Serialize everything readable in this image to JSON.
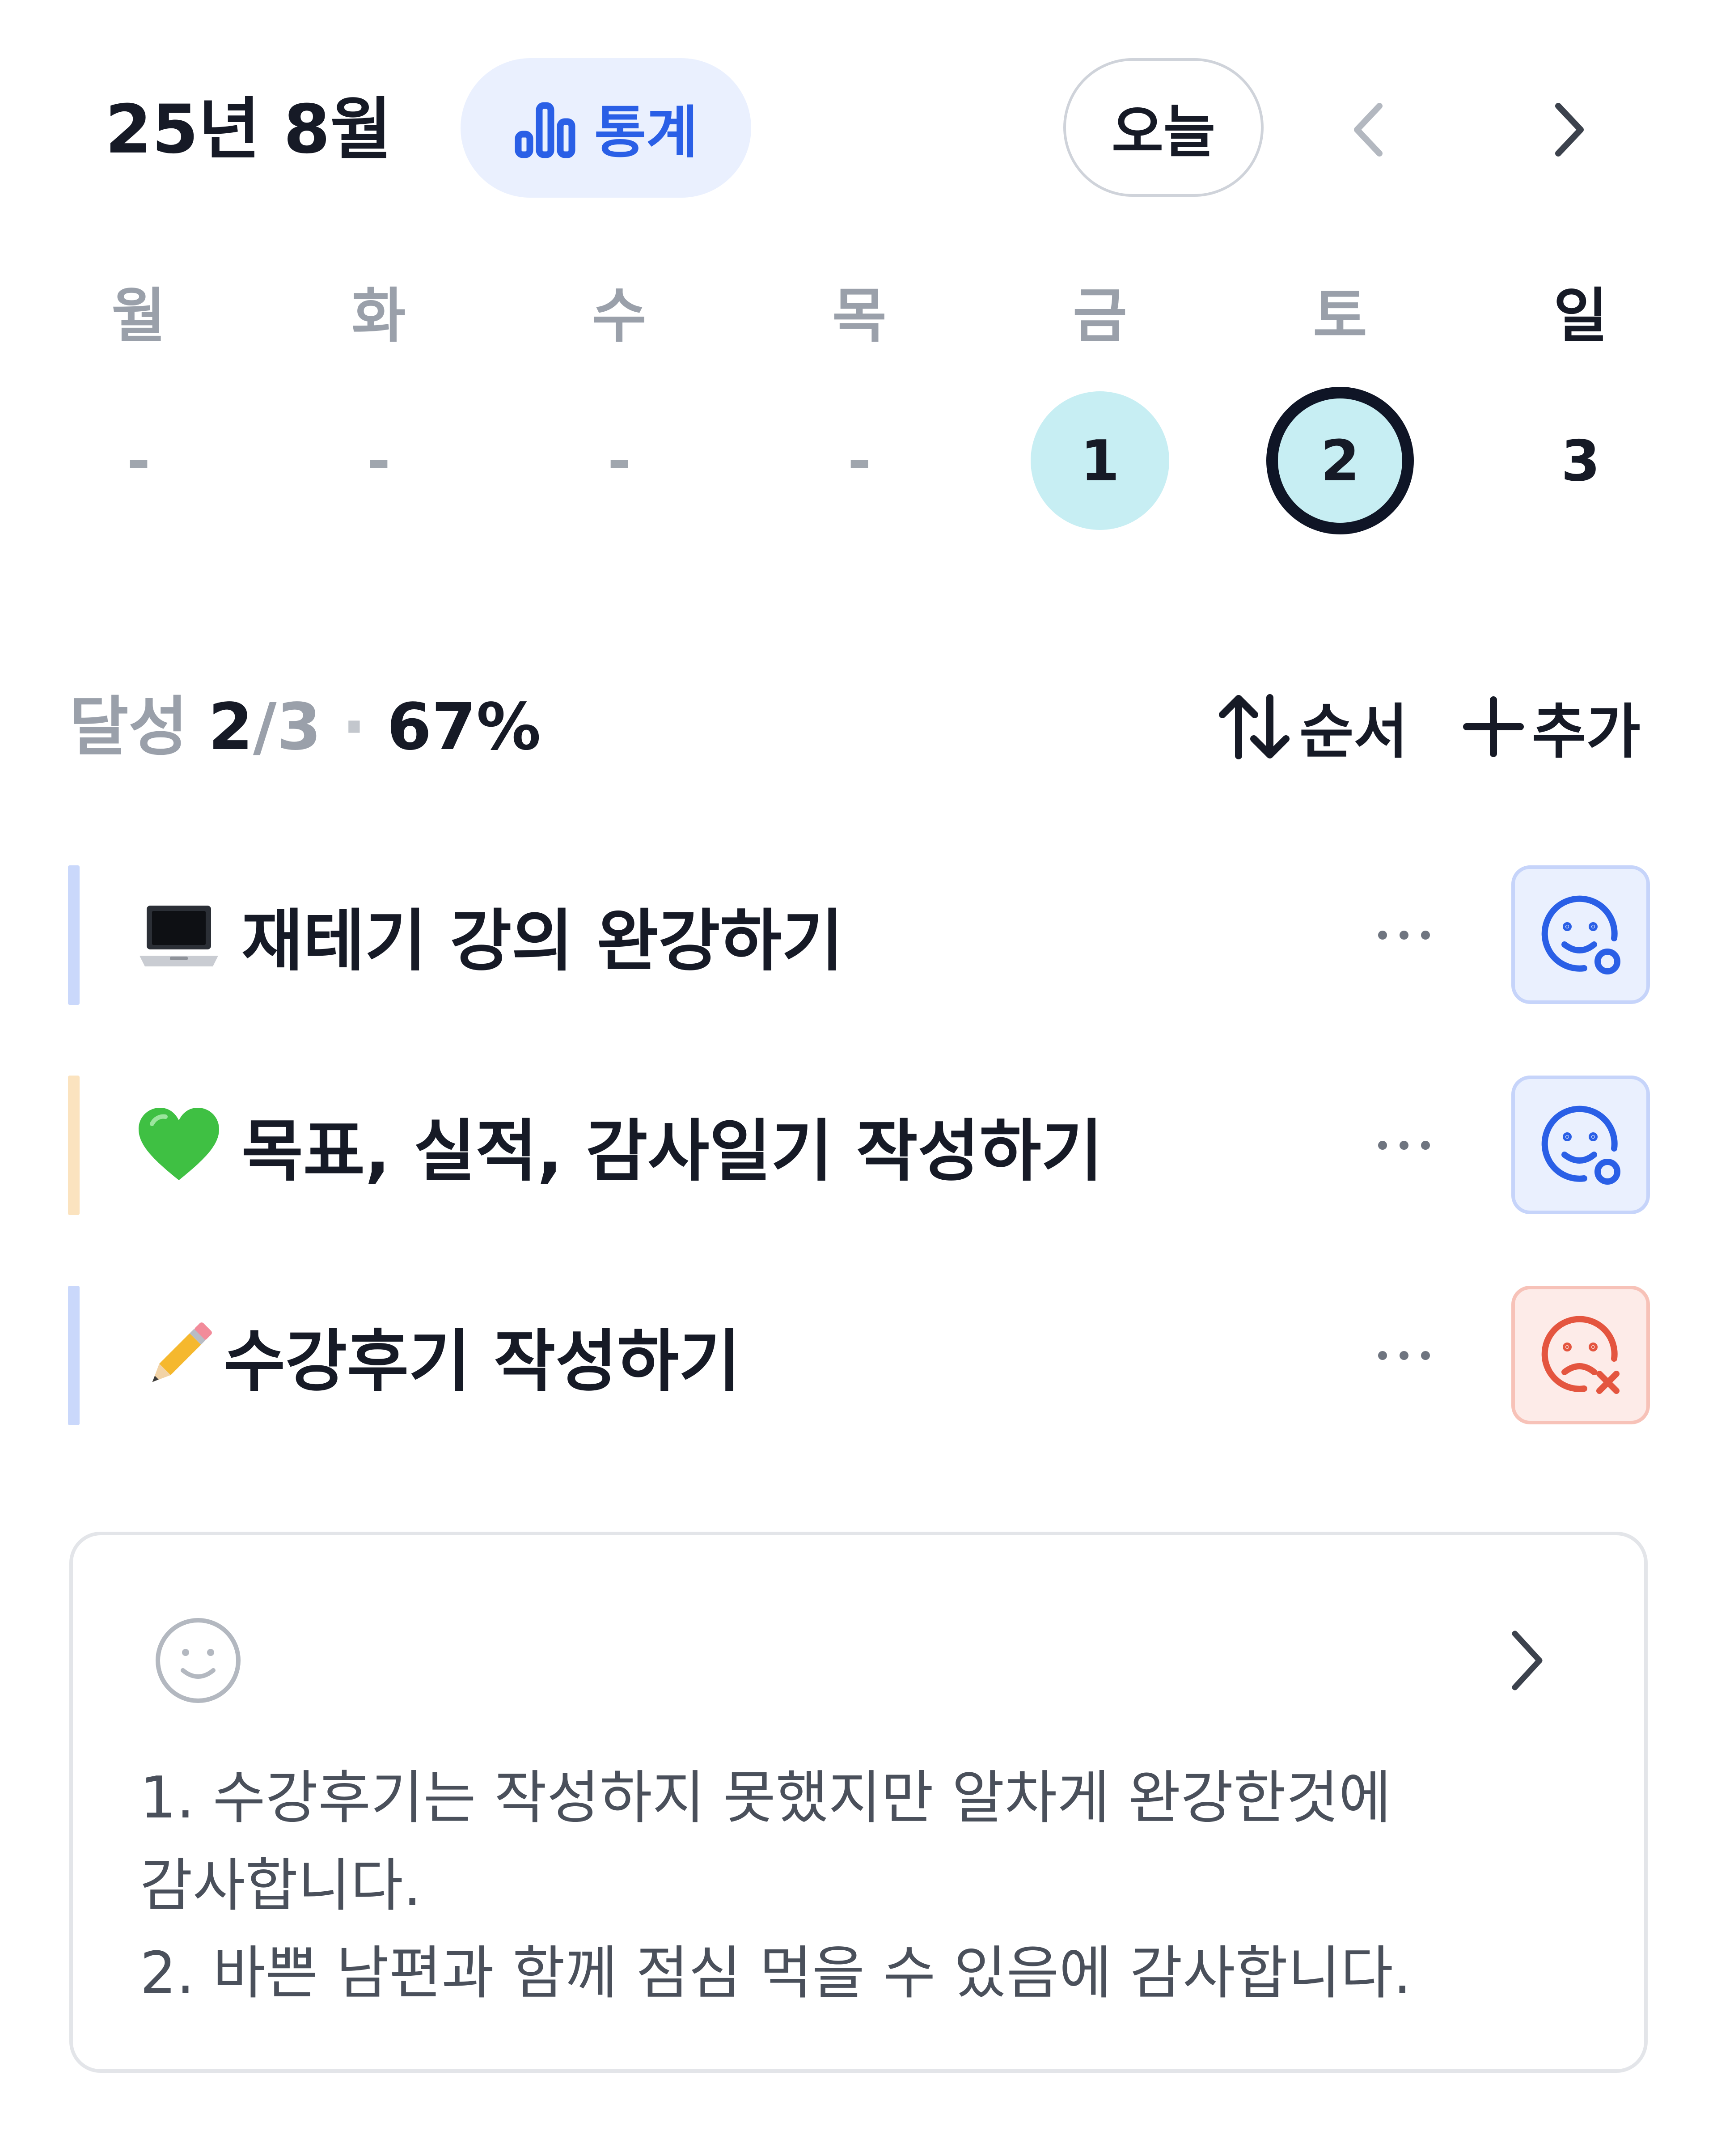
{
  "header": {
    "month_title": "25년 8월",
    "stats_label": "통계",
    "today_label": "오늘"
  },
  "week": {
    "days": [
      "월",
      "화",
      "수",
      "목",
      "금",
      "토",
      "일"
    ],
    "dates": [
      "-",
      "-",
      "-",
      "-",
      "1",
      "2",
      "3"
    ],
    "highlighted": [
      "1",
      "2"
    ],
    "selected": "2"
  },
  "summary": {
    "label": "달성",
    "done": "2",
    "total": "/3",
    "separator": "·",
    "percent": "67%",
    "sort_label": "순서",
    "add_label": "추가"
  },
  "tasks": [
    {
      "emoji": "laptop-icon",
      "title": "재테기 강의 완강하기",
      "status": "done",
      "bar_color": "#cad8fb"
    },
    {
      "emoji": "green-heart-icon",
      "title": "목표, 실적, 감사일기 작성하기",
      "status": "done",
      "bar_color": "#fbe3bf"
    },
    {
      "emoji": "pencil-icon",
      "title": "수강후기 작성하기",
      "status": "fail",
      "bar_color": "#cad8fb"
    }
  ],
  "diary": {
    "text": "1. 수강후기는 작성하지 못했지만 알차게 완강한것에 감사합니다.\n2. 바쁜 남편과 함께 점심 먹을 수 있음에 감사합니다."
  },
  "colors": {
    "accent": "#2a5fe6",
    "accent_bg": "#eaf0fe",
    "fail": "#e4553f",
    "fail_bg": "#fdebe8",
    "highlight": "#c7eef3",
    "text": "#161a26",
    "muted": "#9aa0aa"
  }
}
